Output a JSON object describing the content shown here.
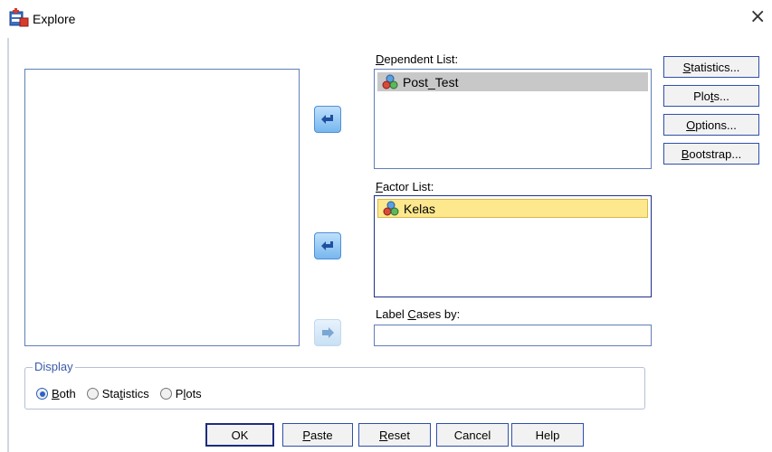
{
  "window": {
    "title": "Explore",
    "close_glyph": "×"
  },
  "dependent_list": {
    "label_prefix": "",
    "label_u": "D",
    "label_rest": "ependent List:",
    "items": [
      {
        "name": "Post_Test",
        "icon": "nominal-variable-icon"
      }
    ]
  },
  "factor_list": {
    "label_u": "F",
    "label_rest": "actor List:",
    "items": [
      {
        "name": "Kelas",
        "icon": "nominal-variable-icon"
      }
    ]
  },
  "label_cases": {
    "label_pre": "Label ",
    "label_u": "C",
    "label_rest": "ases by:",
    "value": ""
  },
  "side_buttons": [
    {
      "pre": "",
      "u": "S",
      "post": "tatistics..."
    },
    {
      "pre": "Plo",
      "u": "t",
      "post": "s..."
    },
    {
      "pre": "",
      "u": "O",
      "post": "ptions..."
    },
    {
      "pre": "",
      "u": "B",
      "post": "ootstrap..."
    }
  ],
  "display": {
    "legend": "Display",
    "options": [
      {
        "u": "B",
        "rest": "oth",
        "pre": "",
        "selected": true
      },
      {
        "pre": "Sta",
        "u": "t",
        "rest": "istics",
        "selected": false
      },
      {
        "pre": "P",
        "u": "l",
        "rest": "ots",
        "selected": false
      }
    ]
  },
  "bottom_buttons": {
    "ok": "OK",
    "paste_u": "P",
    "paste_rest": "aste",
    "reset_u": "R",
    "reset_rest": "eset",
    "cancel": "Cancel",
    "help": "Help"
  },
  "colors": {
    "accent": "#2f4faa",
    "selection_factor": "#fde88e",
    "selection_dependent": "#c8c8c8"
  }
}
